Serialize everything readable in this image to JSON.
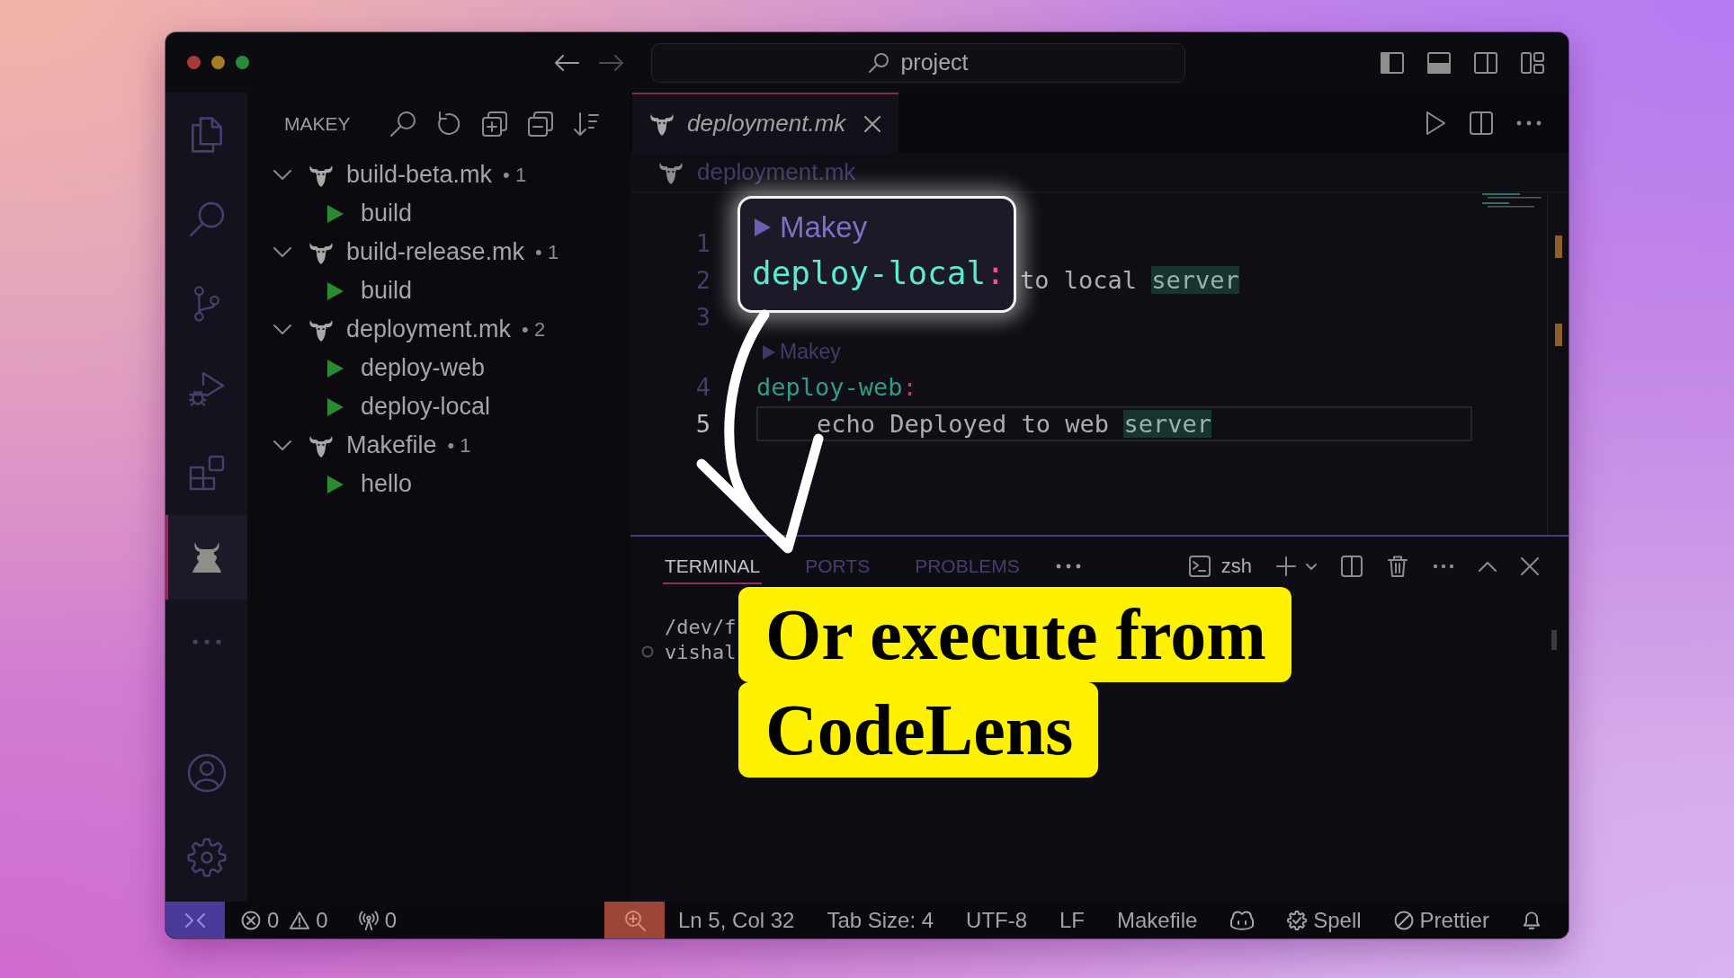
{
  "title_bar": {
    "search": "project"
  },
  "activity_bar": {
    "items": [
      {
        "kind": "files",
        "selected": false
      },
      {
        "kind": "search",
        "selected": false
      },
      {
        "kind": "source_control",
        "selected": false
      },
      {
        "kind": "run_debug",
        "selected": false
      },
      {
        "kind": "extensions",
        "selected": false
      },
      {
        "kind": "makey",
        "selected": true
      },
      {
        "kind": "more",
        "selected": false
      }
    ],
    "bottom": [
      {
        "kind": "account"
      },
      {
        "kind": "settings"
      }
    ]
  },
  "sidebar": {
    "title": "MAKEY",
    "tree": [
      {
        "label": "build-beta.mk",
        "badge": "• 1",
        "expanded": true,
        "children": [
          {
            "label": "build"
          }
        ]
      },
      {
        "label": "build-release.mk",
        "badge": "• 1",
        "expanded": true,
        "children": [
          {
            "label": "build"
          }
        ]
      },
      {
        "label": "deployment.mk",
        "badge": "• 2",
        "expanded": true,
        "children": [
          {
            "label": "deploy-web"
          },
          {
            "label": "deploy-local"
          }
        ]
      },
      {
        "label": "Makefile",
        "badge": "• 1",
        "expanded": true,
        "children": [
          {
            "label": "hello"
          }
        ]
      }
    ]
  },
  "editor": {
    "tabs": [
      {
        "label": "deployment.mk",
        "selected": true,
        "preview": true
      }
    ],
    "breadcrumb": "deployment.mk",
    "lines": [
      {
        "number": "1",
        "current": false
      },
      {
        "number": "2",
        "current": false,
        "indented": false,
        "start_covered": true,
        "tokens": [
          {
            "text": "to local ",
            "kind": "plain"
          },
          {
            "text": "server",
            "kind": "highlight"
          }
        ]
      },
      {
        "number": "3",
        "current": false
      },
      {
        "number": "4",
        "current": false,
        "indented": false,
        "codelens": "Makey",
        "tokens": [
          {
            "text": "deploy-web",
            "kind": "target"
          },
          {
            "text": ":",
            "kind": "colon"
          }
        ]
      },
      {
        "number": "5",
        "current": true,
        "indented": true,
        "tokens": [
          {
            "text": "echo Deployed to web ",
            "kind": "plain"
          },
          {
            "text": "server",
            "kind": "highlight"
          }
        ]
      }
    ],
    "callout": {
      "codelens": "Makey",
      "tokens": [
        {
          "text": "deploy-local",
          "kind": "target"
        },
        {
          "text": ":",
          "kind": "colon"
        }
      ]
    }
  },
  "panel": {
    "tabs": [
      {
        "label": "TERMINAL",
        "selected": true
      },
      {
        "label": "PORTS",
        "selected": false
      },
      {
        "label": "PROBLEMS",
        "selected": false
      }
    ],
    "shell": "zsh",
    "terminal_lines": [
      {
        "text": "/dev/f",
        "marker": false
      },
      {
        "text": "vishal",
        "marker": true
      }
    ]
  },
  "annotation": {
    "caption": "Or execute from CodeLens"
  },
  "status_bar": {
    "left": [
      {
        "kind": "remote"
      },
      {
        "kind": "errors",
        "text": "0"
      },
      {
        "kind": "warnings",
        "text": "0"
      },
      {
        "kind": "ports",
        "text": "0"
      }
    ],
    "right": [
      {
        "kind": "zoom"
      },
      {
        "kind": "text",
        "text": "Ln 5, Col 32"
      },
      {
        "kind": "text",
        "text": "Tab Size: 4"
      },
      {
        "kind": "text",
        "text": "UTF-8"
      },
      {
        "kind": "text",
        "text": "LF"
      },
      {
        "kind": "text",
        "text": "Makefile"
      },
      {
        "kind": "copilot"
      },
      {
        "kind": "spell",
        "text": "Spell"
      },
      {
        "kind": "prettier",
        "text": "Prettier"
      },
      {
        "kind": "bell"
      }
    ]
  }
}
